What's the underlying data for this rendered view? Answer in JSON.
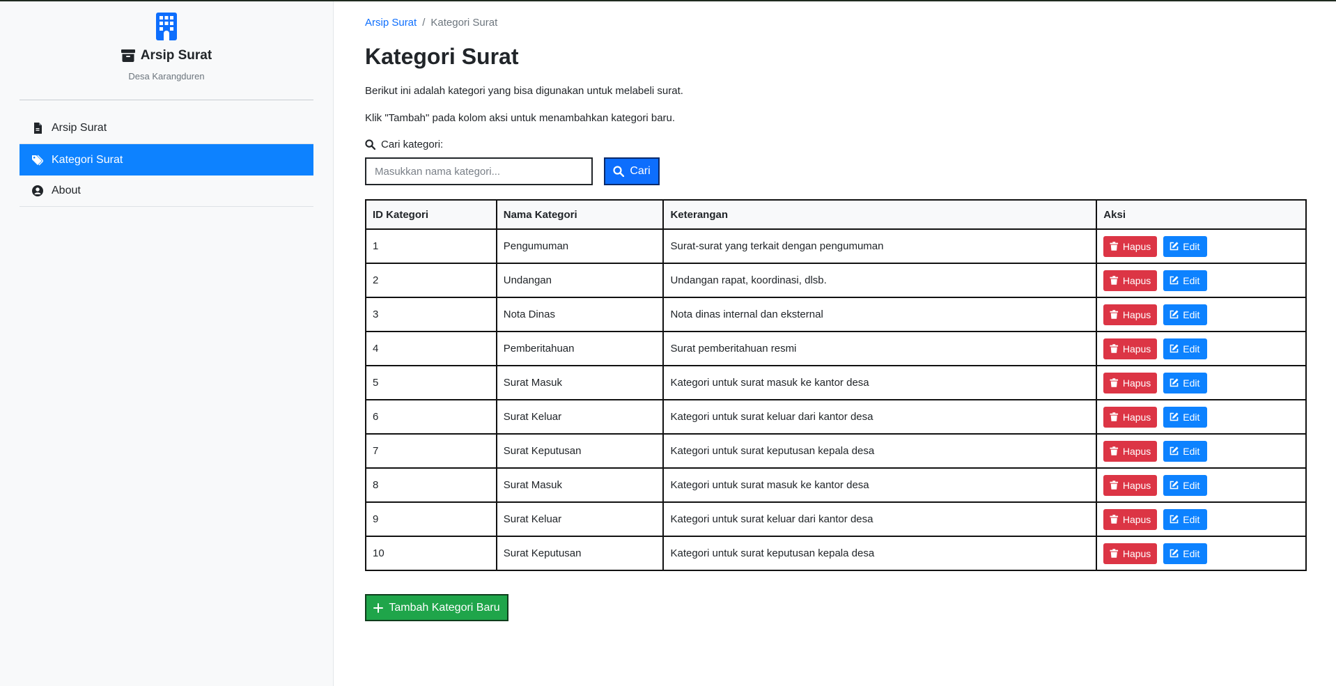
{
  "sidebar": {
    "app_title": "Arsip Surat",
    "subtitle": "Desa Karangduren",
    "items": [
      {
        "label": "Arsip Surat",
        "icon": "file-icon",
        "active": false
      },
      {
        "label": "Kategori Surat",
        "icon": "tags-icon",
        "active": true
      },
      {
        "label": "About",
        "icon": "user-circle-icon",
        "active": false
      }
    ]
  },
  "breadcrumb": {
    "parent": "Arsip Surat",
    "separator": "/",
    "current": "Kategori Surat"
  },
  "page": {
    "title": "Kategori Surat",
    "desc1": "Berikut ini adalah kategori yang bisa digunakan untuk melabeli surat.",
    "desc2": "Klik \"Tambah\" pada kolom aksi untuk menambahkan kategori baru."
  },
  "search": {
    "label": "Cari kategori:",
    "placeholder": "Masukkan nama kategori...",
    "button": "Cari"
  },
  "table": {
    "headers": [
      "ID Kategori",
      "Nama Kategori",
      "Keterangan",
      "Aksi"
    ],
    "rows": [
      {
        "id": "1",
        "nama": "Pengumuman",
        "ket": "Surat-surat yang terkait dengan pengumuman"
      },
      {
        "id": "2",
        "nama": "Undangan",
        "ket": "Undangan rapat, koordinasi, dlsb."
      },
      {
        "id": "3",
        "nama": "Nota Dinas",
        "ket": "Nota dinas internal dan eksternal"
      },
      {
        "id": "4",
        "nama": "Pemberitahuan",
        "ket": "Surat pemberitahuan resmi"
      },
      {
        "id": "5",
        "nama": "Surat Masuk",
        "ket": "Kategori untuk surat masuk ke kantor desa"
      },
      {
        "id": "6",
        "nama": "Surat Keluar",
        "ket": "Kategori untuk surat keluar dari kantor desa"
      },
      {
        "id": "7",
        "nama": "Surat Keputusan",
        "ket": "Kategori untuk surat keputusan kepala desa"
      },
      {
        "id": "8",
        "nama": "Surat Masuk",
        "ket": "Kategori untuk surat masuk ke kantor desa"
      },
      {
        "id": "9",
        "nama": "Surat Keluar",
        "ket": "Kategori untuk surat keluar dari kantor desa"
      },
      {
        "id": "10",
        "nama": "Surat Keputusan",
        "ket": "Kategori untuk surat keputusan kepala desa"
      }
    ],
    "delete_label": "Hapus",
    "edit_label": "Edit"
  },
  "add_button": "Tambah Kategori Baru",
  "colors": {
    "primary": "#0d6efd",
    "danger": "#dc3545",
    "success": "#1fa54a",
    "sidebar_active": "#0d82ff"
  }
}
